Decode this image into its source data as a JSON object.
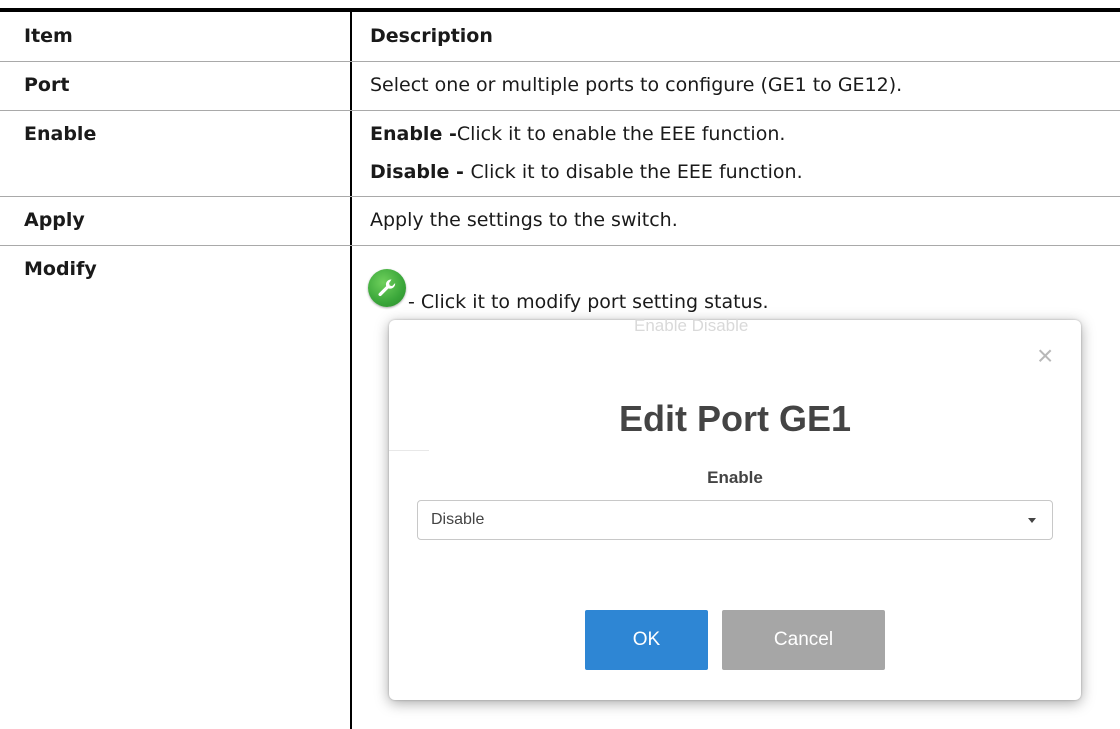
{
  "table": {
    "header": {
      "item": "Item",
      "description": "Description"
    },
    "rows": [
      {
        "item": "Port",
        "description": "Select one or multiple ports to configure (GE1 to GE12)."
      },
      {
        "item": "Enable",
        "lines": [
          {
            "bold": "Enable -",
            "text": "Click it to enable the EEE function."
          },
          {
            "bold": "Disable - ",
            "text": "Click it to disable the EEE function."
          }
        ]
      },
      {
        "item": "Apply",
        "description": "Apply the settings to the switch."
      },
      {
        "item": "Modify",
        "description": "- Click it to modify port setting status.",
        "icon": "wrench-icon"
      }
    ]
  },
  "dialog": {
    "background_text": "Enable  Disable",
    "title": "Edit Port GE1",
    "field_label": "Enable",
    "select_value": "Disable",
    "ok_label": "OK",
    "cancel_label": "Cancel",
    "close_icon": "close-icon"
  },
  "colors": {
    "icon_green": "#3aa63a",
    "ok_blue": "#2e86d4",
    "cancel_gray": "#a6a6a6"
  }
}
